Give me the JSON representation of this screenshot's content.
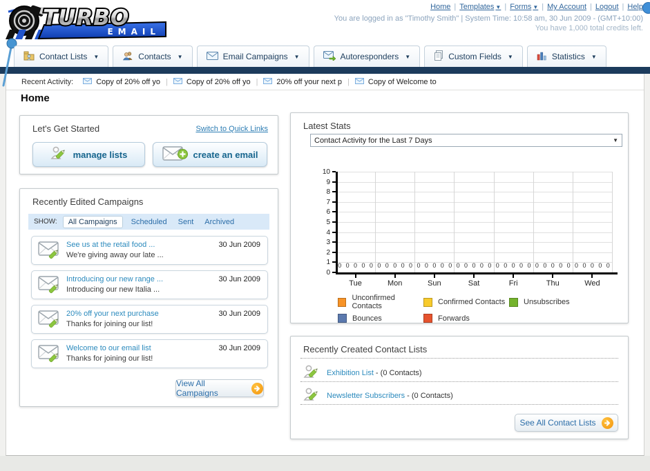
{
  "header": {
    "logo": {
      "title": "TURBO",
      "subtitle": "EMAIL"
    },
    "top_links": [
      {
        "label": "Home",
        "caret": false
      },
      {
        "label": "Templates",
        "caret": true
      },
      {
        "label": "Forms",
        "caret": true
      },
      {
        "label": "My Account",
        "caret": false
      },
      {
        "label": "Logout",
        "caret": false
      },
      {
        "label": "Help",
        "caret": false
      }
    ],
    "login_line": "You are logged in as \"Timothy Smith\" | System Time: 10:58 am, 30 Jun 2009 - (GMT+10:00)",
    "credits_line": "You have 1,000 total credits left."
  },
  "nav": {
    "tabs": [
      {
        "label": "Contact Lists",
        "icon": "folder-user-icon"
      },
      {
        "label": "Contacts",
        "icon": "users-icon"
      },
      {
        "label": "Email Campaigns",
        "icon": "envelope-icon"
      },
      {
        "label": "Autoresponders",
        "icon": "envelope-arrow-icon"
      },
      {
        "label": "Custom Fields",
        "icon": "pages-icon"
      },
      {
        "label": "Statistics",
        "icon": "bar-chart-icon"
      }
    ]
  },
  "recent_activity": {
    "label": "Recent Activity:",
    "items": [
      "Copy of 20% off yo",
      "Copy of 20% off yo",
      "20% off your next p",
      "Copy of Welcome to"
    ]
  },
  "page_title": "Home",
  "get_started": {
    "title": "Let's Get Started",
    "switch_link": "Switch to Quick Links",
    "buttons": [
      {
        "label": "manage lists",
        "icon": "user-pencil-icon"
      },
      {
        "label": "create an email",
        "icon": "envelope-plus-icon"
      }
    ]
  },
  "campaigns": {
    "title": "Recently Edited Campaigns",
    "show_label": "SHOW:",
    "filters": [
      {
        "label": "All Campaigns",
        "active": true
      },
      {
        "label": "Scheduled",
        "active": false
      },
      {
        "label": "Sent",
        "active": false
      },
      {
        "label": "Archived",
        "active": false
      }
    ],
    "items": [
      {
        "title": "See us at the retail food ...",
        "subtitle": "We're giving away our late ...",
        "date": "30 Jun 2009"
      },
      {
        "title": "Introducing our new range ...",
        "subtitle": "Introducing our new Italia ...",
        "date": "30 Jun 2009"
      },
      {
        "title": "20% off your next purchase",
        "subtitle": "Thanks for joining our list!",
        "date": "30 Jun 2009"
      },
      {
        "title": "Welcome to our email list",
        "subtitle": "Thanks for joining our list!",
        "date": "30 Jun 2009"
      }
    ],
    "view_all": "View All Campaigns"
  },
  "stats": {
    "title": "Latest Stats",
    "dropdown_value": "Contact Activity for the Last 7 Days"
  },
  "chart_data": {
    "type": "bar",
    "title": "Contact Activity for the Last 7 Days",
    "categories": [
      "Tue",
      "Mon",
      "Sun",
      "Sat",
      "Fri",
      "Thu",
      "Wed"
    ],
    "series": [
      {
        "name": "Unconfirmed Contacts",
        "color": "#F79327",
        "values": [
          0,
          0,
          0,
          0,
          0,
          0,
          0
        ]
      },
      {
        "name": "Confirmed Contacts",
        "color": "#F8CB2C",
        "values": [
          0,
          0,
          0,
          0,
          0,
          0,
          0
        ]
      },
      {
        "name": "Unsubscribes",
        "color": "#74B32C",
        "values": [
          0,
          0,
          0,
          0,
          0,
          0,
          0
        ]
      },
      {
        "name": "Bounces",
        "color": "#5B79AE",
        "values": [
          0,
          0,
          0,
          0,
          0,
          0,
          0
        ]
      },
      {
        "name": "Forwards",
        "color": "#E6532E",
        "values": [
          0,
          0,
          0,
          0,
          0,
          0,
          0
        ]
      }
    ],
    "ylim": [
      0,
      10
    ],
    "yticks": [
      0,
      1,
      2,
      3,
      4,
      5,
      6,
      7,
      8,
      9,
      10
    ],
    "grid": true,
    "legend_position": "bottom",
    "value_labels_shown": true
  },
  "contact_lists": {
    "title": "Recently Created Contact Lists",
    "items": [
      {
        "name": "Exhibition List",
        "suffix": " - (0 Contacts)"
      },
      {
        "name": "Newsletter Subscribers",
        "suffix": " - (0 Contacts)"
      }
    ],
    "see_all": "See All Contact Lists"
  },
  "colors": {
    "navy_bar": "#1c3b5c",
    "link_blue": "#2b7cb3",
    "button_text_blue": "#15648d",
    "arrow_button_orange": "#f2930d"
  }
}
